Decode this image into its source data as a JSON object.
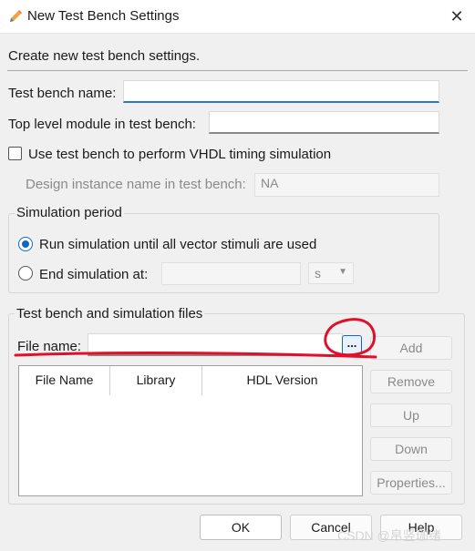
{
  "window": {
    "title": "New Test Bench Settings",
    "icon": "pencil-icon",
    "close_glyph": "✕"
  },
  "intro": "Create new test bench settings.",
  "fields": {
    "test_bench_name_label": "Test bench name:",
    "test_bench_name_value": "",
    "top_level_module_label": "Top level module in test bench:",
    "top_level_module_value": "",
    "vhdl_timing_checkbox_label": "Use test bench to perform VHDL timing simulation",
    "vhdl_timing_checked": false,
    "design_instance_label": "Design instance name in test bench:",
    "design_instance_value": "NA"
  },
  "simulation_period": {
    "title": "Simulation period",
    "run_until_label": "Run simulation until all vector stimuli are used",
    "end_at_label": "End simulation at:",
    "end_at_value": "",
    "unit_selected": "s"
  },
  "files": {
    "title": "Test bench and simulation files",
    "file_name_label": "File name:",
    "file_name_value": "",
    "browse_label": "...",
    "columns": [
      "File Name",
      "Library",
      "HDL Version"
    ],
    "rows": [],
    "buttons": {
      "add": "Add",
      "remove": "Remove",
      "up": "Up",
      "down": "Down",
      "properties": "Properties..."
    }
  },
  "footer": {
    "ok": "OK",
    "cancel": "Cancel",
    "help": "Help"
  },
  "watermark": "CSDN @帛竖珈绪",
  "colors": {
    "accent": "#1567c4",
    "annotation_red": "#e0102a"
  }
}
